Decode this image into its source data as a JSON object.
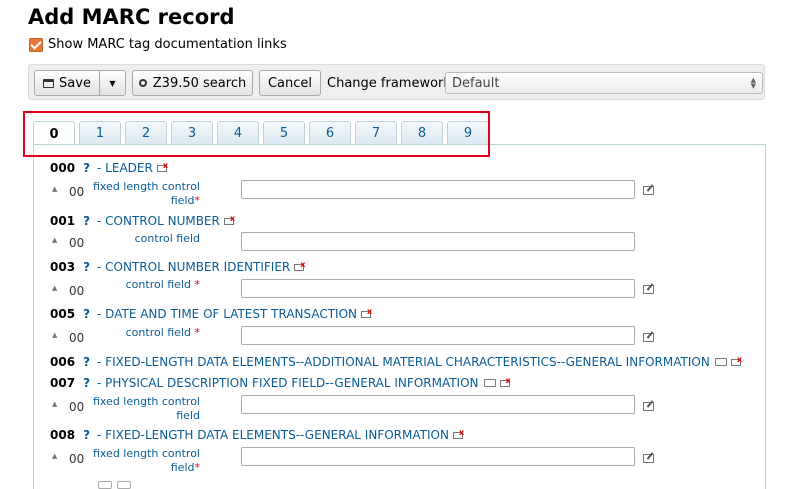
{
  "page": {
    "title": "Add MARC record",
    "show_docs_label": "Show MARC tag documentation links"
  },
  "toolbar": {
    "save_label": "Save",
    "z3950_label": "Z39.50 search",
    "cancel_label": "Cancel",
    "framework_label": "Change framework:",
    "framework_value": "Default"
  },
  "tabs": [
    "0",
    "1",
    "2",
    "3",
    "4",
    "5",
    "6",
    "7",
    "8",
    "9"
  ],
  "active_tab": "0",
  "tags": [
    {
      "num": "000",
      "name": "- LEADER"
    },
    {
      "num": "001",
      "name": "- CONTROL NUMBER"
    },
    {
      "num": "003",
      "name": "- CONTROL NUMBER IDENTIFIER"
    },
    {
      "num": "005",
      "name": "- DATE AND TIME OF LATEST TRANSACTION"
    },
    {
      "num": "006",
      "name": "- FIXED-LENGTH DATA ELEMENTS--ADDITIONAL MATERIAL CHARACTERISTICS--GENERAL INFORMATION"
    },
    {
      "num": "007",
      "name": "- PHYSICAL DESCRIPTION FIXED FIELD--GENERAL INFORMATION"
    },
    {
      "num": "008",
      "name": "- FIXED-LENGTH DATA ELEMENTS--GENERAL INFORMATION"
    }
  ],
  "subfields": [
    {
      "code": "00",
      "label_line1": "fixed length control",
      "label_line2": "field",
      "required": "*"
    },
    {
      "code": "00",
      "label_line1": "control field",
      "label_line2": "",
      "required": ""
    },
    {
      "code": "00",
      "label_line1": "control field",
      "label_line2": "",
      "required": "*"
    },
    {
      "code": "00",
      "label_line1": "control field",
      "label_line2": "",
      "required": "*"
    },
    {
      "code": "00",
      "label_line1": "fixed length control",
      "label_line2": "field",
      "required": ""
    },
    {
      "code": "00",
      "label_line1": "fixed length control",
      "label_line2": "field",
      "required": "*"
    }
  ],
  "glyphs": {
    "question": "?",
    "up_arrow": "▲",
    "caret": "▼",
    "printer": "🖶",
    "search": "⚲"
  }
}
